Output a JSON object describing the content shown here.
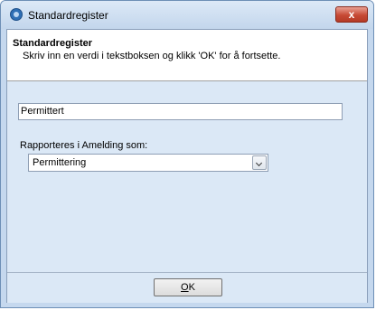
{
  "window": {
    "title": "Standardregister",
    "close_symbol": "x",
    "icon": "app-logo-icon"
  },
  "header": {
    "title": "Standardregister",
    "subtitle": "Skriv inn en verdi i tekstboksen og klikk 'OK' for å fortsette."
  },
  "form": {
    "text_value": "Permittert",
    "combo_label": "Rapporteres i Amelding som:",
    "combo_value": "Permittering"
  },
  "footer": {
    "ok_accel": "O",
    "ok_rest": "K"
  },
  "colors": {
    "content_bg": "#dbe8f6",
    "close_button": "#c74a35"
  }
}
